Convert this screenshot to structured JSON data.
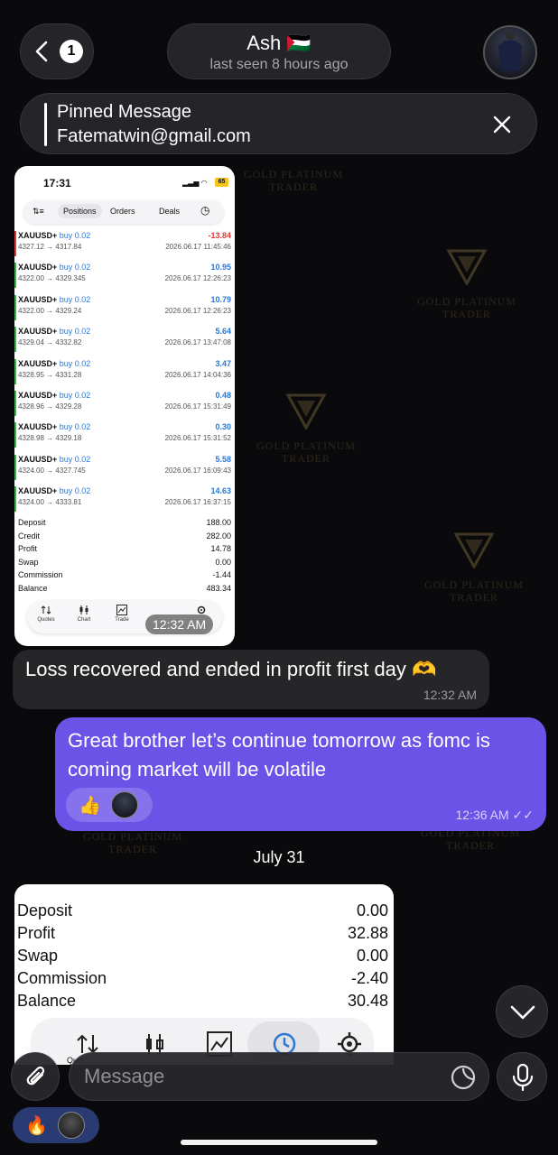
{
  "header": {
    "back_count": "1",
    "contact_name": "Ash 🇵🇸",
    "last_seen": "last seen 8 hours ago"
  },
  "pinned": {
    "title": "Pinned Message",
    "text": "Fatematwin@gmail.com"
  },
  "watermark": {
    "line1": "GOLD PLATINUM",
    "line2": "TRADER"
  },
  "screenshot1": {
    "time": "17:31",
    "battery": "65",
    "tabs": [
      "Positions",
      "Orders",
      "Deals"
    ],
    "trades": [
      {
        "symbol": "XAUUSD+",
        "side": "buy 0.02",
        "prices": "4327.12 → 4317.84",
        "pnl": "-13.84",
        "date": "2026.06.17 11:45:46"
      },
      {
        "symbol": "XAUUSD+",
        "side": "buy 0.02",
        "prices": "4322.00 → 4329.345",
        "pnl": "10.95",
        "date": "2026.06.17 12:26:23"
      },
      {
        "symbol": "XAUUSD+",
        "side": "buy 0.02",
        "prices": "4322.00 → 4329.24",
        "pnl": "10.79",
        "date": "2026.06.17 12:26:23"
      },
      {
        "symbol": "XAUUSD+",
        "side": "buy 0.02",
        "prices": "4329.04 → 4332.82",
        "pnl": "5.64",
        "date": "2026.06.17 13:47:08"
      },
      {
        "symbol": "XAUUSD+",
        "side": "buy 0.02",
        "prices": "4328.95 → 4331.28",
        "pnl": "3.47",
        "date": "2026.06.17 14:04:36"
      },
      {
        "symbol": "XAUUSD+",
        "side": "buy 0.02",
        "prices": "4328.96 → 4329.28",
        "pnl": "0.48",
        "date": "2026.06.17 15:31:49"
      },
      {
        "symbol": "XAUUSD+",
        "side": "buy 0.02",
        "prices": "4328.98 → 4329.18",
        "pnl": "0.30",
        "date": "2026.06.17 15:31:52"
      },
      {
        "symbol": "XAUUSD+",
        "side": "buy 0.02",
        "prices": "4324.00 → 4327.745",
        "pnl": "5.58",
        "date": "2026.06.17 16:09:43"
      },
      {
        "symbol": "XAUUSD+",
        "side": "buy 0.02",
        "prices": "4324.00 → 4333.81",
        "pnl": "14.63",
        "date": "2026.06.17 16:37:15"
      }
    ],
    "summary": [
      {
        "label": "Deposit",
        "value": "188.00"
      },
      {
        "label": "Credit",
        "value": "282.00"
      },
      {
        "label": "Profit",
        "value": "14.78"
      },
      {
        "label": "Swap",
        "value": "0.00"
      },
      {
        "label": "Commission",
        "value": "-1.44"
      },
      {
        "label": "Balance",
        "value": "483.34"
      }
    ],
    "nav": [
      "Quotes",
      "Chart",
      "Trade"
    ],
    "timestamp": "12:32 AM"
  },
  "messages": {
    "incoming": {
      "text": "Loss recovered and ended in profit first day 🫶",
      "time": "12:32 AM"
    },
    "outgoing": {
      "text": "Great brother let’s continue tomorrow as fomc is coming market will be volatile",
      "time": "12:36 AM",
      "reaction": "👍"
    }
  },
  "date_header": "July 31",
  "screenshot2": {
    "summary": [
      {
        "label": "Deposit",
        "value": "0.00"
      },
      {
        "label": "Profit",
        "value": "32.88"
      },
      {
        "label": "Swap",
        "value": "0.00"
      },
      {
        "label": "Commission",
        "value": "-2.40"
      },
      {
        "label": "Balance",
        "value": "30.48"
      }
    ],
    "nav_label": "Quo"
  },
  "composer": {
    "placeholder": "Message"
  },
  "bottom_reaction": "🔥",
  "colors": {
    "outgoing_bubble": "#6b53e8",
    "incoming_bubble": "#262628",
    "profit": "#2a78d6",
    "loss": "#d83a3a"
  }
}
